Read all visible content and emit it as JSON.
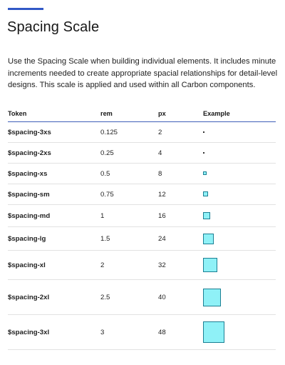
{
  "colors": {
    "accent": "#3259c7",
    "swatch_fill": "#8ff1f7",
    "swatch_border": "#1b7f93",
    "header_rule": "#3f5fb8"
  },
  "page": {
    "title": "Spacing Scale",
    "intro": "Use the Spacing Scale when building individual elements. It includes minute increments needed to create appropriate spacial relationships for detail-level designs. This scale is applied and used within all Carbon components."
  },
  "table": {
    "headers": {
      "token": "Token",
      "rem": "rem",
      "px": "px",
      "example": "Example"
    },
    "rows": [
      {
        "token": "$spacing-3xs",
        "rem": "0.125",
        "px": "2"
      },
      {
        "token": "$spacing-2xs",
        "rem": "0.25",
        "px": "4"
      },
      {
        "token": "$spacing-xs",
        "rem": "0.5",
        "px": "8"
      },
      {
        "token": "$spacing-sm",
        "rem": "0.75",
        "px": "12"
      },
      {
        "token": "$spacing-md",
        "rem": "1",
        "px": "16"
      },
      {
        "token": "$spacing-lg",
        "rem": "1.5",
        "px": "24"
      },
      {
        "token": "$spacing-xl",
        "rem": "2",
        "px": "32"
      },
      {
        "token": "$spacing-2xl",
        "rem": "2.5",
        "px": "40"
      },
      {
        "token": "$spacing-3xl",
        "rem": "3",
        "px": "48"
      }
    ]
  }
}
